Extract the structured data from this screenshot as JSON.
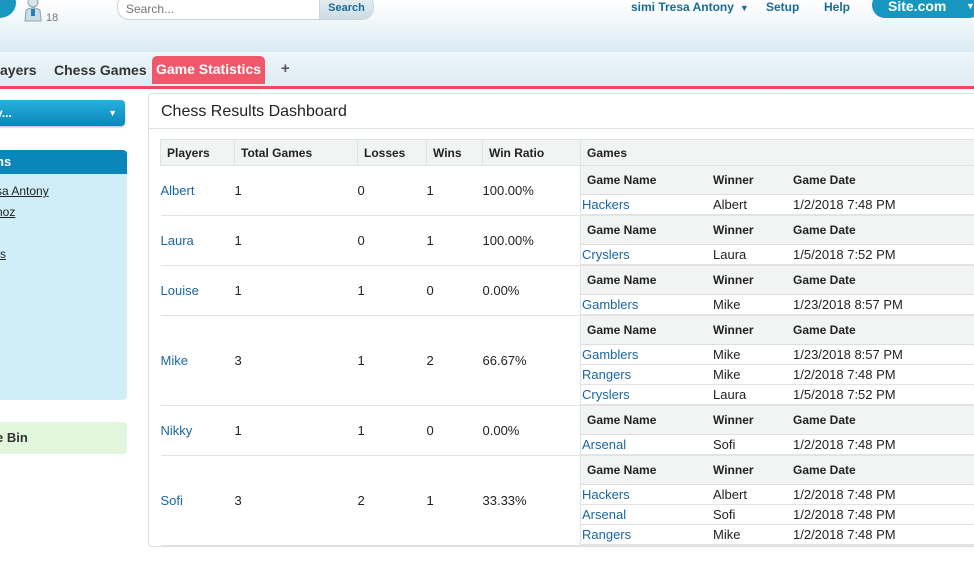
{
  "header": {
    "notification_count": "18",
    "search_placeholder": "Search...",
    "search_button": "Search",
    "user_name": "simi Tresa Antony",
    "setup": "Setup",
    "help": "Help",
    "site_button": "Site.com"
  },
  "tabs": {
    "players": "ayers",
    "chess_games": "Chess Games",
    "game_statistics": "Game Statistics",
    "add": "+"
  },
  "sidebar": {
    "dropdown_label": "y...",
    "panel_title": "ns",
    "links": [
      "sa Antony",
      "noz",
      "rs"
    ],
    "recycle_bin": "e Bin"
  },
  "dashboard": {
    "title": "Chess Results Dashboard",
    "columns": [
      "Players",
      "Total Games",
      "Losses",
      "Wins",
      "Win Ratio",
      "Games"
    ],
    "sub_columns": [
      "Game Name",
      "Winner",
      "Game Date"
    ],
    "rows": [
      {
        "player": "Albert",
        "total": "1",
        "losses": "0",
        "wins": "1",
        "ratio": "100.00%",
        "games": [
          {
            "name": "Hackers",
            "winner": "Albert",
            "date": "1/2/2018 7:48 PM"
          }
        ]
      },
      {
        "player": "Laura",
        "total": "1",
        "losses": "0",
        "wins": "1",
        "ratio": "100.00%",
        "games": [
          {
            "name": "Cryslers",
            "winner": "Laura",
            "date": "1/5/2018 7:52 PM"
          }
        ]
      },
      {
        "player": "Louise",
        "total": "1",
        "losses": "1",
        "wins": "0",
        "ratio": "0.00%",
        "games": [
          {
            "name": "Gamblers",
            "winner": "Mike",
            "date": "1/23/2018 8:57 PM"
          }
        ]
      },
      {
        "player": "Mike",
        "total": "3",
        "losses": "1",
        "wins": "2",
        "ratio": "66.67%",
        "games": [
          {
            "name": "Gamblers",
            "winner": "Mike",
            "date": "1/23/2018 8:57 PM"
          },
          {
            "name": "Rangers",
            "winner": "Mike",
            "date": "1/2/2018 7:48 PM"
          },
          {
            "name": "Cryslers",
            "winner": "Laura",
            "date": "1/5/2018 7:52 PM"
          }
        ]
      },
      {
        "player": "Nikky",
        "total": "1",
        "losses": "1",
        "wins": "0",
        "ratio": "0.00%",
        "games": [
          {
            "name": "Arsenal",
            "winner": "Sofi",
            "date": "1/2/2018 7:48 PM"
          }
        ]
      },
      {
        "player": "Sofi",
        "total": "3",
        "losses": "2",
        "wins": "1",
        "ratio": "33.33%",
        "games": [
          {
            "name": "Hackers",
            "winner": "Albert",
            "date": "1/2/2018 7:48 PM"
          },
          {
            "name": "Arsenal",
            "winner": "Sofi",
            "date": "1/2/2018 7:48 PM"
          },
          {
            "name": "Rangers",
            "winner": "Mike",
            "date": "1/2/2018 7:48 PM"
          }
        ]
      }
    ]
  },
  "colors": {
    "accent": "#1797c0",
    "active_tab": "#f0576a",
    "link": "#1a66a4"
  }
}
